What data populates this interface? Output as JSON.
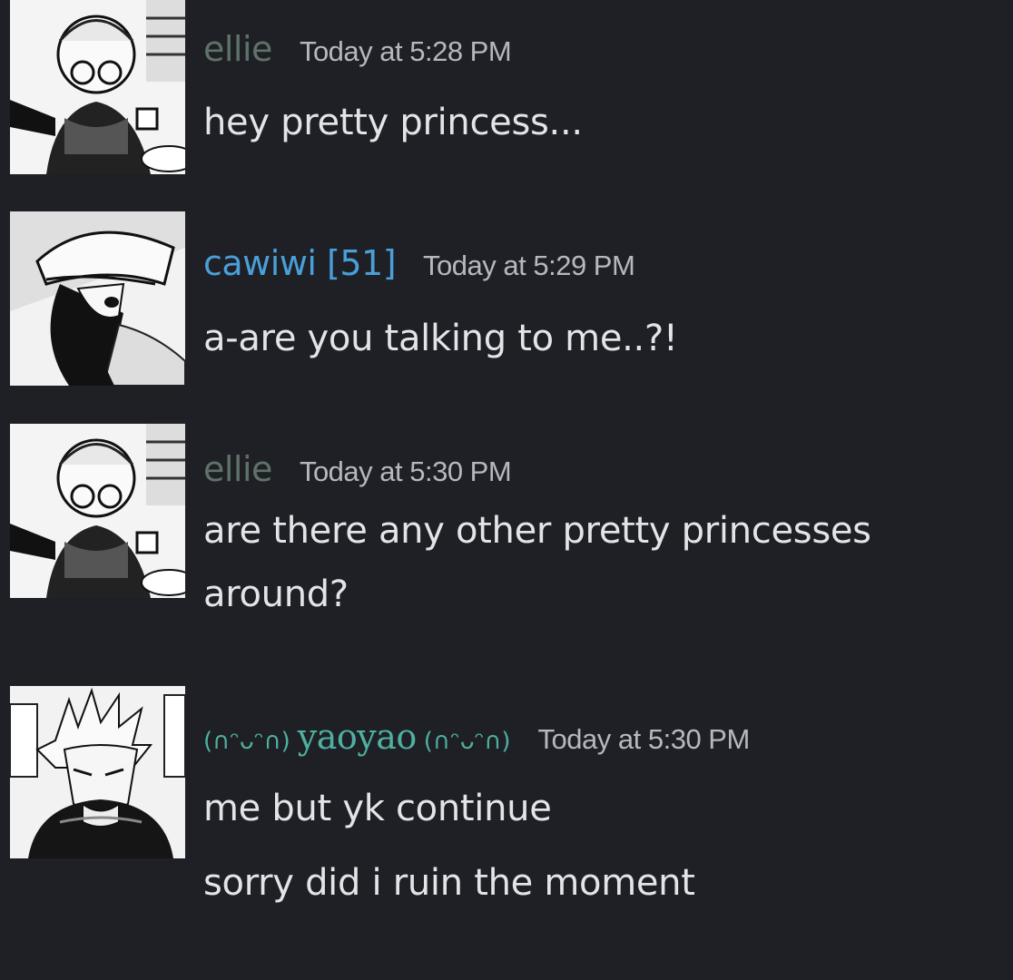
{
  "colors": {
    "background": "#1e2026",
    "ellie_name": "#5f7268",
    "cawiwi_name": "#4a9fd8",
    "yaoyao_name": "#4fb0a0",
    "timestamp": "#b5b8be",
    "message_text": "#e3e4e8"
  },
  "messages": [
    {
      "username": "ellie",
      "timestamp": "Today at 5:28 PM",
      "avatar_icon": "manga-character-with-glasses-avatar",
      "lines": [
        "hey pretty princess..."
      ]
    },
    {
      "username": "cawiwi [51]",
      "timestamp": "Today at 5:29 PM",
      "avatar_icon": "manga-character-with-cap-avatar",
      "lines": [
        "a-are you talking to me..?!"
      ]
    },
    {
      "username": "ellie",
      "timestamp": "Today at 5:30 PM",
      "avatar_icon": "manga-character-with-glasses-avatar",
      "lines": [
        "are there any other pretty princesses",
        "around?"
      ]
    },
    {
      "username_prefix": "(∩ᵔᴗᵔ∩)",
      "username": "yaoyao",
      "username_suffix": "(∩ᵔᴗᵔ∩)",
      "timestamp": "Today at 5:30 PM",
      "avatar_icon": "manga-character-spiky-hair-avatar",
      "lines": [
        "me but yk continue",
        "sorry did i ruin the moment"
      ]
    }
  ]
}
